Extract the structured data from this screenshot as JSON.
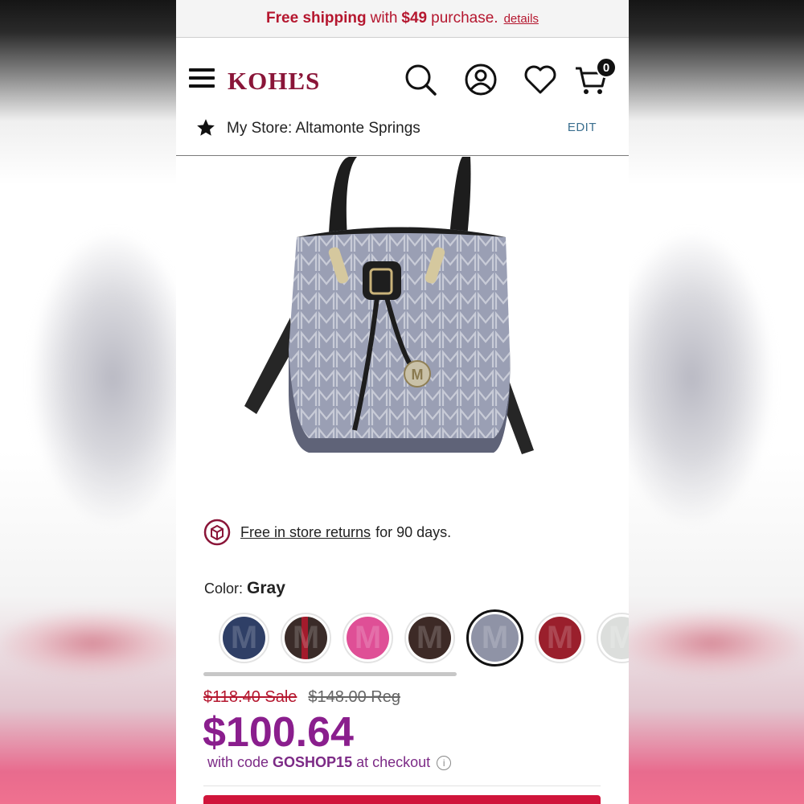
{
  "promo": {
    "free_shipping": "Free shipping",
    "with": "with",
    "amount": "$49",
    "purchase": "purchase.",
    "details_link": "details"
  },
  "header": {
    "logo": "KOHĽS",
    "cart_count": "0",
    "icons": [
      "menu-icon",
      "search-icon",
      "account-icon",
      "heart-icon",
      "cart-icon"
    ]
  },
  "store": {
    "label": "My Store: Altamonte Springs",
    "edit": "EDIT"
  },
  "returns": {
    "link": "Free in store returns",
    "suffix": "for 90 days."
  },
  "color": {
    "label": "Color:",
    "selected": "Gray",
    "swatches": [
      {
        "name": "navy",
        "color": "#2f3f66"
      },
      {
        "name": "black-red",
        "color": "#3a2b28"
      },
      {
        "name": "pink",
        "color": "#df4f96"
      },
      {
        "name": "brown",
        "color": "#3d2a26"
      },
      {
        "name": "gray",
        "color": "#8f93a6"
      },
      {
        "name": "red",
        "color": "#9a1f2c"
      },
      {
        "name": "white",
        "color": "#dcdedc"
      }
    ]
  },
  "pricing": {
    "sale_old": "$118.40 Sale",
    "reg_old": "$148.00 Reg",
    "price_now": "$100.64",
    "code_prefix": "with code",
    "code": "GOSHOP15",
    "code_suffix": "at checkout"
  },
  "colors": {
    "brand": "#8a1538",
    "promo_red": "#b5172f",
    "price_purple": "#8a1e8d",
    "cta_red": "#d0153b"
  }
}
